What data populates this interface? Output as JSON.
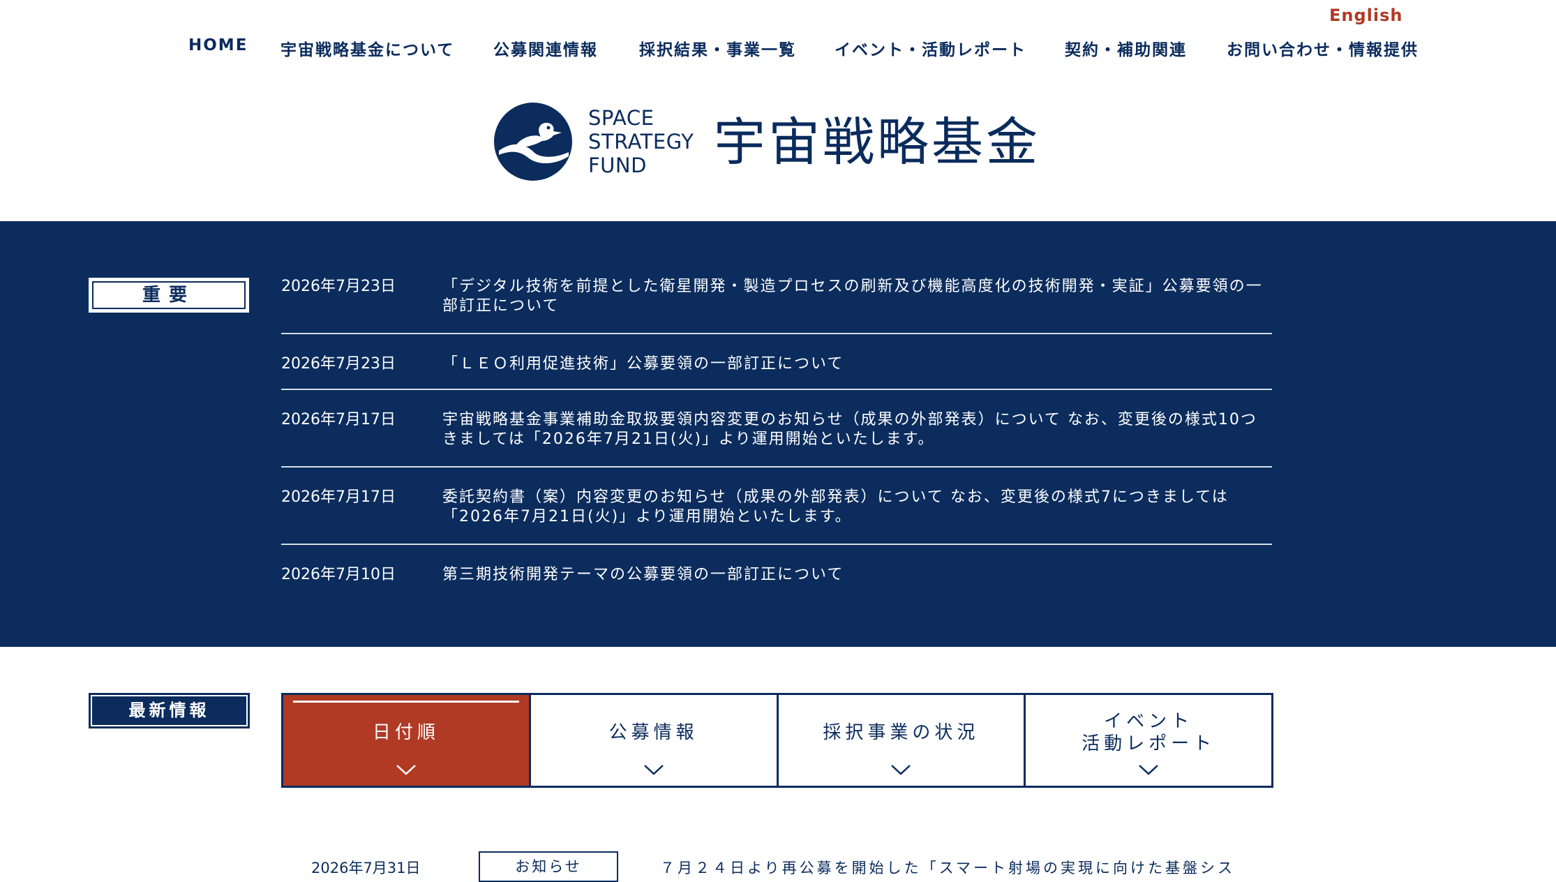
{
  "header": {
    "lang_link": "English",
    "nav": [
      "HOME",
      "宇宙戦略基金について",
      "公募関連情報",
      "採択結果・事業一覧",
      "イベント・活動レポート",
      "契約・補助関連",
      "お問い合わせ・情報提供"
    ],
    "logo_en": [
      "SPACE",
      "STRATEGY",
      "FUND"
    ],
    "logo_ja": "宇宙戦略基金"
  },
  "important": {
    "label": "重要",
    "items": [
      {
        "date": "2026年7月23日",
        "text": "「デジタル技術を前提とした衛星開発・製造プロセスの刷新及び機能高度化の技術開発・実証」公募要領の一部訂正について"
      },
      {
        "date": "2026年7月23日",
        "text": "「ＬＥＯ利用促進技術」公募要領の一部訂正について"
      },
      {
        "date": "2026年7月17日",
        "text": "宇宙戦略基金事業補助金取扱要領内容変更のお知らせ（成果の外部発表）について なお、変更後の様式10つきましては「2026年7月21日(火)」より運用開始といたします。"
      },
      {
        "date": "2026年7月17日",
        "text": "委託契約書（案）内容変更のお知らせ（成果の外部発表）について なお、変更後の様式7につきましては「2026年7月21日(火)」より運用開始といたします。"
      },
      {
        "date": "2026年7月10日",
        "text": "第三期技術開発テーマの公募要領の一部訂正について"
      }
    ]
  },
  "latest": {
    "label": "最新情報",
    "tabs": [
      "日付順",
      "公募情報",
      "採択事業の状況",
      "イベント\n活動レポート"
    ],
    "active_tab": 0,
    "news": [
      {
        "date": "2026年7月31日",
        "tag": "お知らせ",
        "text": "７月２４日より再公募を開始した「スマート射場の実現に向けた基盤シス"
      }
    ]
  },
  "colors": {
    "navy": "#0b2c5d",
    "accent_red": "#b03a24",
    "white": "#ffffff"
  }
}
